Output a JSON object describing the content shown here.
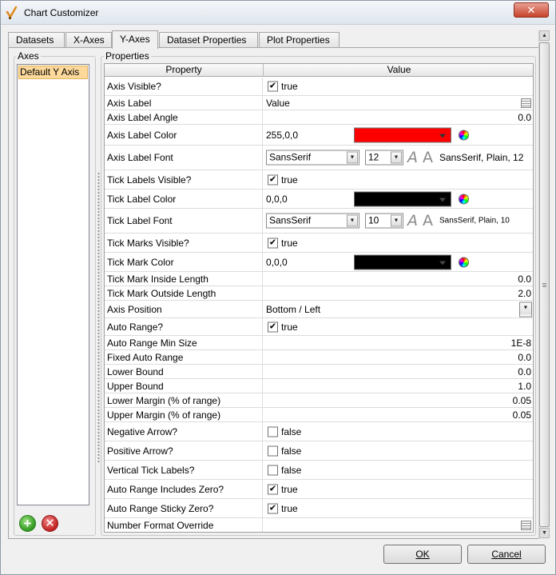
{
  "window": {
    "title": "Chart Customizer",
    "close_glyph": "✕",
    "app_icon": "chart-customizer-check-icon"
  },
  "tabs": [
    {
      "label": "Datasets",
      "active": false
    },
    {
      "label": "X-Axes",
      "active": false
    },
    {
      "label": "Y-Axes",
      "active": true
    },
    {
      "label": "Dataset Properties",
      "active": false
    },
    {
      "label": "Plot Properties",
      "active": false
    }
  ],
  "axes_panel": {
    "group_label": "Axes",
    "items": [
      "Default Y Axis"
    ],
    "add_glyph": "+",
    "remove_glyph": "✕"
  },
  "properties_panel": {
    "group_label": "Properties",
    "columns": {
      "property": "Property",
      "value": "Value"
    },
    "rows": [
      {
        "name": "Axis Visible?",
        "type": "bool",
        "checked": true,
        "value": "true"
      },
      {
        "name": "Axis Label",
        "type": "text-edit",
        "value": "Value"
      },
      {
        "name": "Axis Label Angle",
        "type": "number",
        "value": "0.0"
      },
      {
        "name": "Axis Label Color",
        "type": "color",
        "value": "255,0,0",
        "swatch": "#ff0000"
      },
      {
        "name": "Axis Label Font",
        "type": "font",
        "family": "SansSerif",
        "size": "12",
        "value": "SansSerif, Plain, 12",
        "aa_italic": "A",
        "aa_plain": "A"
      },
      {
        "name": "Tick Labels Visible?",
        "type": "bool",
        "checked": true,
        "value": "true"
      },
      {
        "name": "Tick Label Color",
        "type": "color",
        "value": "0,0,0",
        "swatch": "#000000"
      },
      {
        "name": "Tick Label Font",
        "type": "font",
        "family": "SansSerif",
        "size": "10",
        "value": "SansSerif, Plain, 10",
        "aa_italic": "A",
        "aa_plain": "A"
      },
      {
        "name": "Tick Marks Visible?",
        "type": "bool",
        "checked": true,
        "value": "true"
      },
      {
        "name": "Tick Mark Color",
        "type": "color",
        "value": "0,0,0",
        "swatch": "#000000"
      },
      {
        "name": "Tick Mark Inside Length",
        "type": "number",
        "value": "0.0"
      },
      {
        "name": "Tick Mark Outside Length",
        "type": "number",
        "value": "2.0"
      },
      {
        "name": "Axis Position",
        "type": "select",
        "value": "Bottom / Left"
      },
      {
        "name": "Auto Range?",
        "type": "bool",
        "checked": true,
        "value": "true"
      },
      {
        "name": "Auto Range Min Size",
        "type": "number",
        "value": "1E-8"
      },
      {
        "name": "Fixed Auto Range",
        "type": "number",
        "value": "0.0"
      },
      {
        "name": "Lower Bound",
        "type": "number",
        "value": "0.0"
      },
      {
        "name": "Upper Bound",
        "type": "number",
        "value": "1.0"
      },
      {
        "name": "Lower Margin (% of range)",
        "type": "number",
        "value": "0.05"
      },
      {
        "name": "Upper Margin (% of range)",
        "type": "number",
        "value": "0.05"
      },
      {
        "name": "Negative Arrow?",
        "type": "bool",
        "checked": false,
        "value": "false"
      },
      {
        "name": "Positive Arrow?",
        "type": "bool",
        "checked": false,
        "value": "false"
      },
      {
        "name": "Vertical Tick Labels?",
        "type": "bool",
        "checked": false,
        "value": "false"
      },
      {
        "name": "Auto Range Includes Zero?",
        "type": "bool",
        "checked": true,
        "value": "true"
      },
      {
        "name": "Auto Range Sticky Zero?",
        "type": "bool",
        "checked": true,
        "value": "true"
      },
      {
        "name": "Number Format Override",
        "type": "text-edit",
        "value": ""
      }
    ]
  },
  "footer": {
    "ok_label": "OK",
    "cancel_label": "Cancel"
  },
  "colors": {
    "selection": "#fdd99b",
    "close_button": "#c7432b"
  }
}
